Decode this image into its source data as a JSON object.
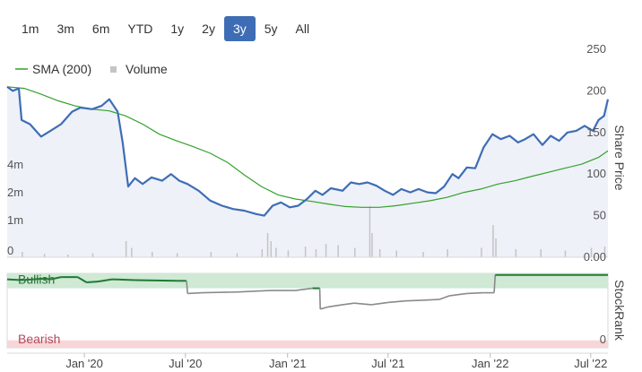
{
  "range_buttons": [
    {
      "label": "1m",
      "active": false
    },
    {
      "label": "3m",
      "active": false
    },
    {
      "label": "6m",
      "active": false
    },
    {
      "label": "YTD",
      "active": false
    },
    {
      "label": "1y",
      "active": false
    },
    {
      "label": "2y",
      "active": false
    },
    {
      "label": "3y",
      "active": true
    },
    {
      "label": "5y",
      "active": false
    },
    {
      "label": "All",
      "active": false
    }
  ],
  "colors": {
    "price": "#3e6db5",
    "sma": "#33a02c",
    "volume": "#c4c4c4",
    "stockrank_bullish": "#1f7a33",
    "stockrank_neutral": "#8a8a8a",
    "bullish_band": "#cfe9d4",
    "bearish_band": "#f8d6d8",
    "price_fill": "#eef1f8",
    "active_button": "#3e6db5"
  },
  "chart_data": [
    {
      "type": "line",
      "name": "price-panel",
      "legend": [
        {
          "label": "SMA (200)",
          "icon": "line",
          "series": "sma"
        },
        {
          "label": "Volume",
          "icon": "square",
          "series": "volume"
        }
      ],
      "ylabel": "Share Price",
      "right_ticks": [
        "250",
        "200",
        "150",
        "100",
        "50",
        "0.00"
      ],
      "right_tick_values": [
        250,
        200,
        150,
        100,
        50,
        0
      ],
      "ylim": [
        0,
        250
      ],
      "left_ticks": [
        "4m",
        "2m",
        "1m",
        "0"
      ],
      "x_ticks": [
        "Jan '20",
        "Jul '20",
        "Jan '21",
        "Jul '21",
        "Jan '22",
        "Jul '22"
      ],
      "x_tick_dates": [
        "2020-01-01",
        "2020-07-01",
        "2021-01-01",
        "2021-07-01",
        "2022-01-01",
        "2022-07-01"
      ],
      "x_range": [
        "2019-08-15",
        "2022-08-01"
      ],
      "series": [
        {
          "key": "price",
          "points": [
            [
              "2019-08-15",
              205
            ],
            [
              "2019-08-25",
              200
            ],
            [
              "2019-09-05",
              203
            ],
            [
              "2019-09-10",
              165
            ],
            [
              "2019-09-25",
              160
            ],
            [
              "2019-10-15",
              145
            ],
            [
              "2019-11-01",
              152
            ],
            [
              "2019-11-20",
              160
            ],
            [
              "2019-12-10",
              175
            ],
            [
              "2019-12-25",
              180
            ],
            [
              "2020-01-15",
              178
            ],
            [
              "2020-02-01",
              182
            ],
            [
              "2020-02-15",
              190
            ],
            [
              "2020-03-01",
              175
            ],
            [
              "2020-03-10",
              138
            ],
            [
              "2020-03-20",
              85
            ],
            [
              "2020-04-01",
              95
            ],
            [
              "2020-04-15",
              88
            ],
            [
              "2020-05-01",
              96
            ],
            [
              "2020-05-20",
              92
            ],
            [
              "2020-06-05",
              100
            ],
            [
              "2020-06-20",
              92
            ],
            [
              "2020-07-05",
              88
            ],
            [
              "2020-07-25",
              80
            ],
            [
              "2020-08-15",
              68
            ],
            [
              "2020-09-05",
              62
            ],
            [
              "2020-09-25",
              58
            ],
            [
              "2020-10-15",
              56
            ],
            [
              "2020-11-05",
              52
            ],
            [
              "2020-11-20",
              50
            ],
            [
              "2020-12-05",
              62
            ],
            [
              "2020-12-20",
              66
            ],
            [
              "2021-01-05",
              60
            ],
            [
              "2021-01-20",
              62
            ],
            [
              "2021-02-05",
              70
            ],
            [
              "2021-02-20",
              80
            ],
            [
              "2021-03-05",
              75
            ],
            [
              "2021-03-20",
              83
            ],
            [
              "2021-04-10",
              80
            ],
            [
              "2021-04-25",
              90
            ],
            [
              "2021-05-10",
              88
            ],
            [
              "2021-05-25",
              90
            ],
            [
              "2021-06-10",
              86
            ],
            [
              "2021-06-25",
              80
            ],
            [
              "2021-07-10",
              75
            ],
            [
              "2021-07-25",
              82
            ],
            [
              "2021-08-10",
              78
            ],
            [
              "2021-08-25",
              82
            ],
            [
              "2021-09-10",
              78
            ],
            [
              "2021-09-25",
              77
            ],
            [
              "2021-10-10",
              85
            ],
            [
              "2021-10-25",
              100
            ],
            [
              "2021-11-05",
              95
            ],
            [
              "2021-11-20",
              108
            ],
            [
              "2021-12-05",
              107
            ],
            [
              "2021-12-20",
              132
            ],
            [
              "2022-01-05",
              148
            ],
            [
              "2022-01-20",
              142
            ],
            [
              "2022-02-05",
              146
            ],
            [
              "2022-02-20",
              138
            ],
            [
              "2022-03-05",
              142
            ],
            [
              "2022-03-20",
              148
            ],
            [
              "2022-04-05",
              135
            ],
            [
              "2022-04-20",
              146
            ],
            [
              "2022-05-05",
              140
            ],
            [
              "2022-05-20",
              150
            ],
            [
              "2022-06-05",
              152
            ],
            [
              "2022-06-20",
              158
            ],
            [
              "2022-07-05",
              152
            ],
            [
              "2022-07-15",
              165
            ],
            [
              "2022-07-25",
              170
            ],
            [
              "2022-08-01",
              190
            ]
          ]
        },
        {
          "key": "sma",
          "points": [
            [
              "2019-08-15",
              205
            ],
            [
              "2019-09-15",
              203
            ],
            [
              "2019-10-15",
              196
            ],
            [
              "2019-11-15",
              188
            ],
            [
              "2019-12-15",
              182
            ],
            [
              "2020-01-15",
              178
            ],
            [
              "2020-02-15",
              176
            ],
            [
              "2020-03-15",
              170
            ],
            [
              "2020-04-15",
              160
            ],
            [
              "2020-05-15",
              148
            ],
            [
              "2020-06-15",
              140
            ],
            [
              "2020-07-15",
              133
            ],
            [
              "2020-08-15",
              125
            ],
            [
              "2020-09-15",
              114
            ],
            [
              "2020-10-15",
              99
            ],
            [
              "2020-11-15",
              85
            ],
            [
              "2020-12-15",
              75
            ],
            [
              "2021-01-15",
              70
            ],
            [
              "2021-02-15",
              67
            ],
            [
              "2021-03-15",
              64
            ],
            [
              "2021-04-15",
              61
            ],
            [
              "2021-05-15",
              60
            ],
            [
              "2021-06-15",
              60
            ],
            [
              "2021-07-15",
              62
            ],
            [
              "2021-08-15",
              65
            ],
            [
              "2021-09-15",
              68
            ],
            [
              "2021-10-15",
              72
            ],
            [
              "2021-11-15",
              78
            ],
            [
              "2021-12-15",
              82
            ],
            [
              "2022-01-15",
              88
            ],
            [
              "2022-02-15",
              92
            ],
            [
              "2022-03-15",
              97
            ],
            [
              "2022-04-15",
              102
            ],
            [
              "2022-05-15",
              107
            ],
            [
              "2022-06-15",
              112
            ],
            [
              "2022-07-15",
              120
            ],
            [
              "2022-08-01",
              128
            ]
          ]
        }
      ]
    },
    {
      "type": "line",
      "name": "stockrank-panel",
      "ylabel": "StockRank",
      "right_ticks": [
        "0"
      ],
      "bands": [
        {
          "label": "Bullish",
          "range": [
            80,
            100
          ]
        },
        {
          "label": "Bearish",
          "range": [
            0,
            10
          ]
        }
      ],
      "ylim": [
        0,
        100
      ],
      "series": [
        {
          "key": "stockrank",
          "points": [
            [
              "2019-08-15",
              92
            ],
            [
              "2019-09-10",
              91
            ],
            [
              "2019-10-01",
              92
            ],
            [
              "2019-10-20",
              93
            ],
            [
              "2019-11-01",
              92
            ],
            [
              "2019-11-20",
              95
            ],
            [
              "2019-12-20",
              95
            ],
            [
              "2020-01-05",
              88
            ],
            [
              "2020-01-25",
              89
            ],
            [
              "2020-02-20",
              92
            ],
            [
              "2020-04-01",
              91
            ],
            [
              "2020-06-15",
              90
            ],
            [
              "2020-07-03",
              90
            ],
            [
              "2020-07-05",
              73
            ],
            [
              "2020-08-01",
              74
            ],
            [
              "2020-10-01",
              75
            ],
            [
              "2020-12-01",
              77
            ],
            [
              "2021-01-15",
              77
            ],
            [
              "2021-02-15",
              80
            ],
            [
              "2021-02-28",
              80
            ],
            [
              "2021-03-01",
              52
            ],
            [
              "2021-03-15",
              55
            ],
            [
              "2021-04-10",
              58
            ],
            [
              "2021-05-01",
              60
            ],
            [
              "2021-06-01",
              58
            ],
            [
              "2021-07-01",
              61
            ],
            [
              "2021-08-01",
              63
            ],
            [
              "2021-09-01",
              64
            ],
            [
              "2021-10-01",
              65
            ],
            [
              "2021-10-20",
              70
            ],
            [
              "2021-11-20",
              73
            ],
            [
              "2021-12-20",
              74
            ],
            [
              "2022-01-08",
              74
            ],
            [
              "2022-01-10",
              98
            ],
            [
              "2022-04-01",
              98
            ],
            [
              "2022-08-01",
              98
            ]
          ]
        }
      ]
    }
  ],
  "volume": [
    [
      "2019-09-10",
      0.2
    ],
    [
      "2019-10-20",
      0.12
    ],
    [
      "2019-12-01",
      0.1
    ],
    [
      "2020-01-15",
      0.15
    ],
    [
      "2020-03-15",
      0.6
    ],
    [
      "2020-03-25",
      0.35
    ],
    [
      "2020-05-01",
      0.2
    ],
    [
      "2020-06-15",
      0.15
    ],
    [
      "2020-08-15",
      0.2
    ],
    [
      "2020-10-01",
      0.15
    ],
    [
      "2020-11-15",
      0.3
    ],
    [
      "2020-11-25",
      0.9
    ],
    [
      "2020-12-01",
      0.6
    ],
    [
      "2020-12-10",
      0.35
    ],
    [
      "2021-01-01",
      0.25
    ],
    [
      "2021-02-01",
      0.4
    ],
    [
      "2021-02-20",
      0.3
    ],
    [
      "2021-03-10",
      0.5
    ],
    [
      "2021-04-01",
      0.45
    ],
    [
      "2021-05-01",
      0.35
    ],
    [
      "2021-05-28",
      1.9
    ],
    [
      "2021-06-01",
      0.9
    ],
    [
      "2021-06-15",
      0.3
    ],
    [
      "2021-07-15",
      0.25
    ],
    [
      "2021-09-01",
      0.2
    ],
    [
      "2021-10-15",
      0.3
    ],
    [
      "2021-12-15",
      0.35
    ],
    [
      "2022-01-05",
      1.2
    ],
    [
      "2022-01-10",
      0.7
    ],
    [
      "2022-02-15",
      0.3
    ],
    [
      "2022-04-01",
      0.3
    ],
    [
      "2022-05-15",
      0.25
    ],
    [
      "2022-07-01",
      0.35
    ],
    [
      "2022-07-25",
      0.4
    ]
  ]
}
